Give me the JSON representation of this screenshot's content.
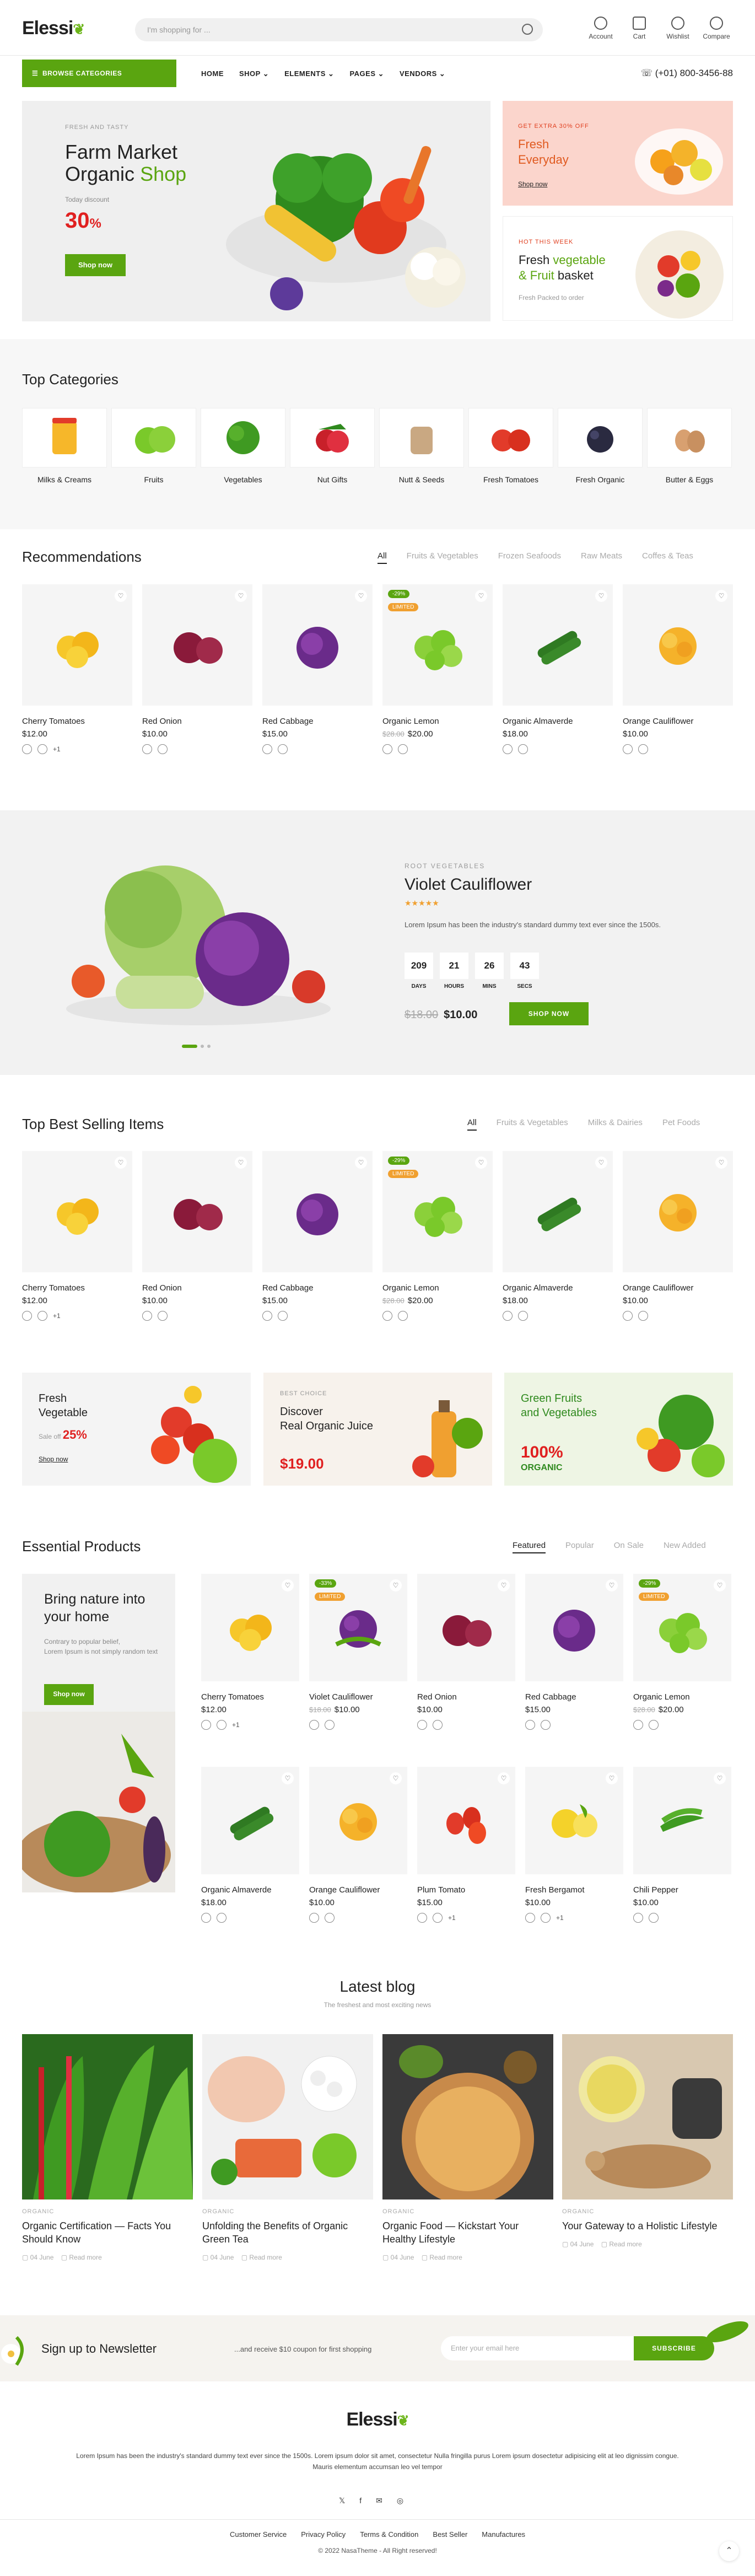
{
  "header": {
    "logo": "Elessi",
    "search_placeholder": "I'm shopping for ...",
    "icons": [
      {
        "label": "Account",
        "icon": "user-icon"
      },
      {
        "label": "Cart",
        "icon": "cart-icon"
      },
      {
        "label": "Wishlist",
        "icon": "heart-icon"
      },
      {
        "label": "Compare",
        "icon": "compare-icon"
      }
    ]
  },
  "nav": {
    "browse": "BROWSE CATEGORIES",
    "menu": [
      "HOME",
      "SHOP",
      "ELEMENTS",
      "PAGES",
      "VENDORS"
    ],
    "phone": "(+01) 800-3456-88"
  },
  "hero": {
    "eyebrow": "FRESH AND TASTY",
    "title1": "Farm Market",
    "title2a": "Organic",
    "title2b": "Shop",
    "discount_label": "Today discount",
    "discount": "30",
    "discount_pct": "%",
    "button": "Shop now"
  },
  "side1": {
    "eyebrow": "GET EXTRA 30% OFF",
    "title1": "Fresh",
    "title2": "Everyday",
    "link": "Shop now"
  },
  "side2": {
    "eyebrow": "HOT THIS WEEK",
    "t1": "Fresh ",
    "t1g": "vegetable",
    "t2a": "& Fruit",
    "t2b": " basket",
    "sub": "Fresh Packed to order"
  },
  "categories": {
    "title": "Top Categories",
    "items": [
      "Milks & Creams",
      "Fruits",
      "Vegetables",
      "Nut Gifts",
      "Nutt & Seeds",
      "Fresh Tomatoes",
      "Fresh Organic",
      "Butter & Eggs"
    ]
  },
  "recommend": {
    "title": "Recommendations",
    "tabs": [
      "All",
      "Fruits & Vegetables",
      "Frozen Seafoods",
      "Raw Meats",
      "Coffes & Teas"
    ]
  },
  "products": [
    {
      "name": "Cherry Tomatoes",
      "price": "$12.00",
      "old": "",
      "b1": "",
      "b2": "",
      "extra": "+1"
    },
    {
      "name": "Red Onion",
      "price": "$10.00",
      "old": "",
      "b1": "",
      "b2": "",
      "extra": ""
    },
    {
      "name": "Red Cabbage",
      "price": "$15.00",
      "old": "",
      "b1": "",
      "b2": "",
      "extra": ""
    },
    {
      "name": "Organic Lemon",
      "price": "$20.00",
      "old": "$28.00",
      "b1": "-29%",
      "b2": "LIMITED",
      "extra": ""
    },
    {
      "name": "Organic Almaverde",
      "price": "$18.00",
      "old": "",
      "b1": "",
      "b2": "",
      "extra": ""
    },
    {
      "name": "Orange Cauliflower",
      "price": "$10.00",
      "old": "",
      "b1": "",
      "b2": "",
      "extra": ""
    }
  ],
  "deal": {
    "eyebrow": "ROOT VEGETABLES",
    "title": "Violet Cauliflower",
    "stars": "★★★★★",
    "desc": "Lorem Ipsum has been the industry's standard dummy text ever since the 1500s.",
    "count": [
      {
        "v": "209",
        "l": "DAYS"
      },
      {
        "v": "21",
        "l": "HOURS"
      },
      {
        "v": "26",
        "l": "MINS"
      },
      {
        "v": "43",
        "l": "SECS"
      }
    ],
    "old": "$18.00",
    "price": "$10.00",
    "button": "SHOP NOW"
  },
  "bestselling": {
    "title": "Top Best Selling Items",
    "tabs": [
      "All",
      "Fruits & Vegetables",
      "Milks & Dairies",
      "Pet Foods"
    ]
  },
  "promos": [
    {
      "t1": "Fresh",
      "t2": "Vegetable",
      "sale": "Sale off",
      "pct": "25%",
      "link": "Shop now"
    },
    {
      "eyebrow": "BEST CHOICE",
      "t1": "Discover",
      "t2": "Real Organic Juice",
      "price": "$19.00"
    },
    {
      "t1": "Green Fruits",
      "t2": "and Vegetables",
      "big": "100%",
      "sub": "ORGANIC"
    }
  ],
  "essential": {
    "title": "Essential Products",
    "tabs": [
      "Featured",
      "Popular",
      "On Sale",
      "New Added"
    ],
    "banner_title": "Bring nature into your home",
    "banner_text1": "Contrary to popular belief,",
    "banner_text2": "Lorem Ipsum is not simply random text",
    "banner_btn": "Shop now",
    "items": [
      {
        "name": "Cherry Tomatoes",
        "price": "$12.00",
        "old": "",
        "b1": "",
        "b2": "",
        "extra": "+1"
      },
      {
        "name": "Violet Cauliflower",
        "price": "$10.00",
        "old": "$18.00",
        "b1": "-33%",
        "b2": "LIMITED",
        "extra": ""
      },
      {
        "name": "Red Onion",
        "price": "$10.00",
        "old": "",
        "b1": "",
        "b2": "",
        "extra": ""
      },
      {
        "name": "Red Cabbage",
        "price": "$15.00",
        "old": "",
        "b1": "",
        "b2": "",
        "extra": ""
      },
      {
        "name": "Organic Lemon",
        "price": "$20.00",
        "old": "$28.00",
        "b1": "-29%",
        "b2": "LIMITED",
        "extra": ""
      },
      {
        "name": "Organic Almaverde",
        "price": "$18.00",
        "old": "",
        "b1": "",
        "b2": "",
        "extra": ""
      },
      {
        "name": "Orange Cauliflower",
        "price": "$10.00",
        "old": "",
        "b1": "",
        "b2": "",
        "extra": ""
      },
      {
        "name": "Plum Tomato",
        "price": "$15.00",
        "old": "",
        "b1": "",
        "b2": "",
        "extra": "+1"
      },
      {
        "name": "Fresh Bergamot",
        "price": "$10.00",
        "old": "",
        "b1": "",
        "b2": "",
        "extra": "+1"
      },
      {
        "name": "Chili Pepper",
        "price": "$10.00",
        "old": "",
        "b1": "",
        "b2": "",
        "extra": ""
      }
    ]
  },
  "blog": {
    "title": "Latest blog",
    "subtitle": "The freshest and most exciting news",
    "posts": [
      {
        "cat": "ORGANIC",
        "title": "Organic Certification — Facts You Should Know",
        "date": "04 June",
        "more": "Read more"
      },
      {
        "cat": "ORGANIC",
        "title": "Unfolding the Benefits of Organic Green Tea",
        "date": "04 June",
        "more": "Read more"
      },
      {
        "cat": "ORGANIC",
        "title": "Organic Food — Kickstart Your Healthy Lifestyle",
        "date": "04 June",
        "more": "Read more"
      },
      {
        "cat": "ORGANIC",
        "title": "Your Gateway to a Holistic Lifestyle",
        "date": "04 June",
        "more": "Read more"
      }
    ]
  },
  "newsletter": {
    "title": "Sign up to Newsletter",
    "text": "...and receive $10 coupon for first shopping",
    "placeholder": "Enter your email here",
    "button": "SUBSCRIBE"
  },
  "footer": {
    "logo": "Elessi",
    "text1": "Lorem Ipsum has been the industry's standard dummy text ever since the 1500s. Lorem ipsum dolor sit amet, consectetur Nulla fringilla purus Lorem ipsum dosectetur adipisicing elit at leo dignissim congue.",
    "text2": "Mauris elementum accumsan leo vel tempor",
    "links": [
      "Customer Service",
      "Privacy Policy",
      "Terms & Condition",
      "Best Seller",
      "Manufactures"
    ],
    "copyright": "© 2022 NasaTheme - All Right reserved!"
  },
  "colors": {
    "accent": "#5aa510",
    "red": "#e02020",
    "orange": "#f0a030"
  }
}
